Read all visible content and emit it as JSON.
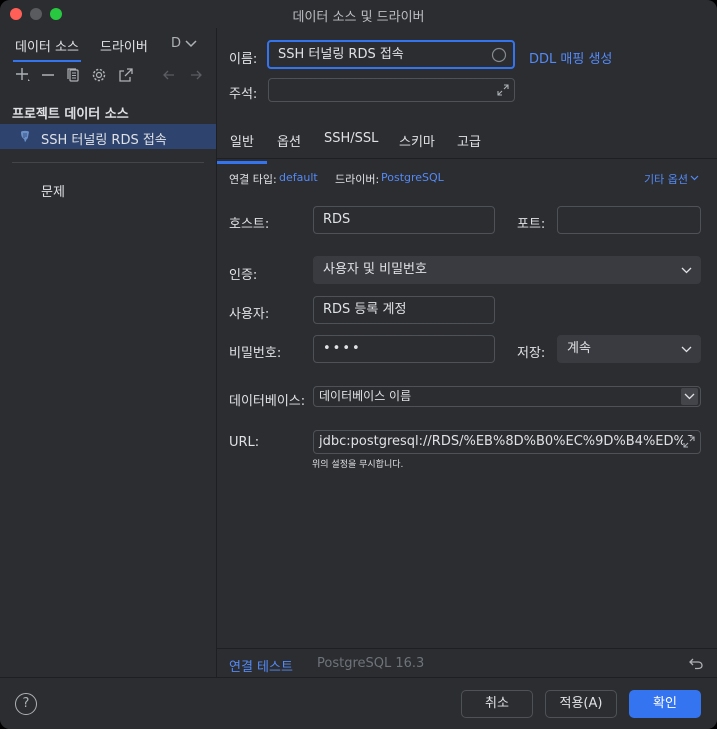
{
  "window": {
    "title": "데이터 소스 및 드라이버"
  },
  "left": {
    "tabs": [
      "데이터 소스",
      "드라이버",
      "D"
    ],
    "section_title": "프로젝트 데이터 소스",
    "items": [
      {
        "label": "SSH 터널링 RDS 접속",
        "icon": "postgresql-elephant-icon"
      }
    ],
    "problems_label": "문제"
  },
  "form": {
    "name_label": "이름:",
    "name_value": "SSH 터널링 RDS 접속",
    "ddl_link": "DDL 매핑 생성",
    "comment_label": "주석:",
    "comment_value": "",
    "tabs": [
      "일반",
      "옵션",
      "SSH/SSL",
      "스키마",
      "고급"
    ],
    "connection_type_label": "연결 타입:",
    "connection_type_value": "default",
    "driver_label": "드라이버:",
    "driver_value": "PostgreSQL",
    "other_options": "기타 옵션",
    "host_label": "호스트:",
    "host_value": "RDS",
    "port_label": "포트:",
    "port_value": "",
    "auth_label": "인증:",
    "auth_value": "사용자 및 비밀번호",
    "user_label": "사용자:",
    "user_value": "RDS 등록 계정",
    "password_label": "비밀번호:",
    "password_value": "••••",
    "save_label": "저장:",
    "save_value": "계속",
    "database_label": "데이터베이스:",
    "database_placeholder": "데이터베이스 이름",
    "url_label": "URL:",
    "url_value": "jdbc:postgresql://RDS/%EB%8D%B0%EC%9D%B4%ED%8",
    "url_hint": "위의 설정을 무시합니다."
  },
  "bottom": {
    "test_connection": "연결 테스트",
    "version": "PostgreSQL 16.3"
  },
  "footer": {
    "help": "?",
    "cancel": "취소",
    "apply": "적용(A)",
    "ok": "확인"
  },
  "colors": {
    "accent": "#3574f0",
    "link": "#548af7",
    "selection": "#2e436e"
  }
}
